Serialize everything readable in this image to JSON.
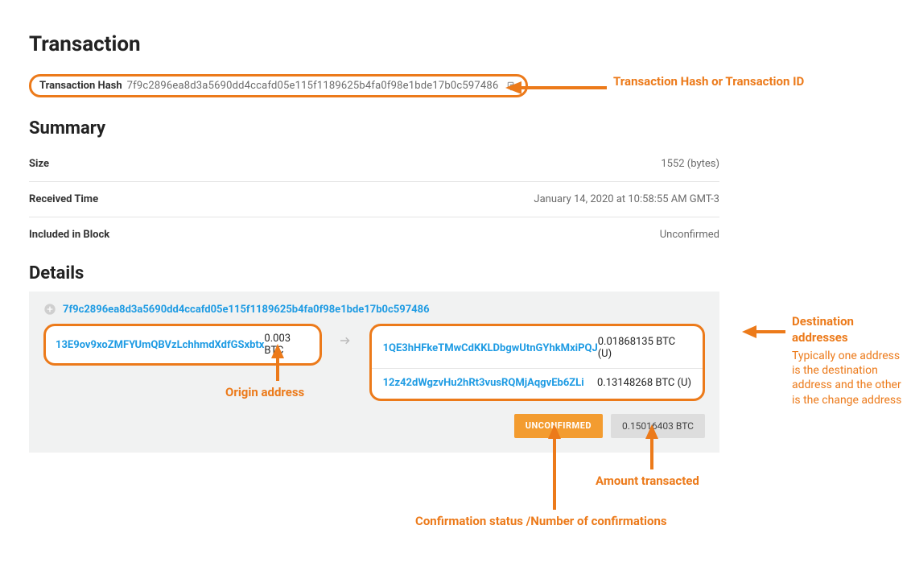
{
  "page_title": "Transaction",
  "tx_hash_label": "Transaction Hash",
  "tx_hash": "7f9c2896ea8d3a5690dd4ccafd05e115f1189625b4fa0f98e1bde17b0c597486",
  "summary_heading": "Summary",
  "summary_rows": [
    {
      "label": "Size",
      "value": "1552 (bytes)"
    },
    {
      "label": "Received Time",
      "value": "January 14, 2020 at 10:58:55 AM GMT-3"
    },
    {
      "label": "Included in Block",
      "value": "Unconfirmed"
    }
  ],
  "details_heading": "Details",
  "detail_hash": "7f9c2896ea8d3a5690dd4ccafd05e115f1189625b4fa0f98e1bde17b0c597486",
  "inputs": [
    {
      "address": "13E9ov9xoZMFYUmQBVzLchhmdXdfGSxbtx",
      "amount": "0.003 BTC"
    }
  ],
  "outputs": [
    {
      "address": "1QE3hHFkeTMwCdKKLDbgwUtnGYhkMxiPQJ",
      "amount": "0.01868135 BTC (U)"
    },
    {
      "address": "12z42dWgzvHu2hRt3vusRQMjAqgvEb6ZLi",
      "amount": "0.13148268 BTC (U)"
    }
  ],
  "status_badge": "UNCONFIRMED",
  "total_badge": "0.15016403 BTC",
  "annotations": {
    "hash": "Transaction Hash or Transaction ID",
    "origin": "Origin address",
    "dest_title": "Destination addresses",
    "dest_sub": "Typically one address is the destination address and the other is the change address",
    "amount": "Amount transacted",
    "confirm": "Confirmation status /Number of confirmations"
  }
}
